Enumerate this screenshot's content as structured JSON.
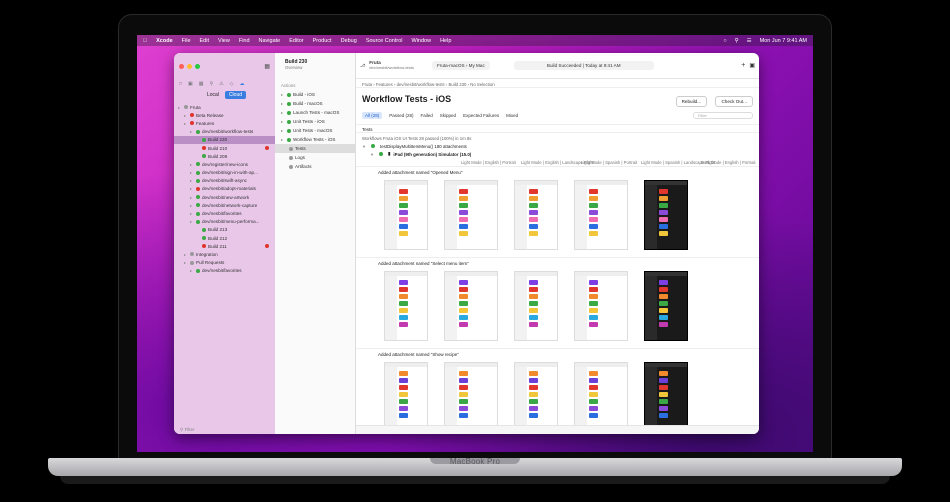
{
  "menubar": {
    "app": "Xcode",
    "items": [
      "File",
      "Edit",
      "View",
      "Find",
      "Navigate",
      "Editor",
      "Product",
      "Debug",
      "Source Control",
      "Window",
      "Help"
    ],
    "clock": "Mon Jun 7  9:41 AM"
  },
  "sidebar": {
    "segments": [
      "Local",
      "Cloud"
    ],
    "active_segment": "Cloud",
    "filter_placeholder": "Filter",
    "items": [
      {
        "label": "Fruta",
        "level": 0,
        "status": "gray"
      },
      {
        "label": "Beta Release",
        "level": 1,
        "status": "red"
      },
      {
        "label": "Features",
        "level": 1,
        "status": "red"
      },
      {
        "label": "dev/nesbit/workflow-tests",
        "level": 2,
        "status": "green"
      },
      {
        "label": "Build 230",
        "level": 3,
        "status": "green",
        "selected": true
      },
      {
        "label": "Build 210",
        "level": 3,
        "status": "red",
        "badge": true
      },
      {
        "label": "Build 209",
        "level": 3,
        "status": "green"
      },
      {
        "label": "dev/register/new-icons",
        "level": 2,
        "status": "green"
      },
      {
        "label": "dev/nesbit/sign-in-with-ap...",
        "level": 2,
        "status": "green"
      },
      {
        "label": "dev/nesbit/swift-async",
        "level": 2,
        "status": "green"
      },
      {
        "label": "dev/nesbit/adopt-materials",
        "level": 2,
        "status": "red"
      },
      {
        "label": "dev/nesbit/new-artwork",
        "level": 2,
        "status": "green"
      },
      {
        "label": "dev/nesbit/network-capture",
        "level": 2,
        "status": "green"
      },
      {
        "label": "dev/nesbit/favorites",
        "level": 2,
        "status": "green"
      },
      {
        "label": "dev/nesbit/menu-performa...",
        "level": 2,
        "status": "green"
      },
      {
        "label": "Build 213",
        "level": 3,
        "status": "green"
      },
      {
        "label": "Build 212",
        "level": 3,
        "status": "green"
      },
      {
        "label": "Build 211",
        "level": 3,
        "status": "red",
        "badge": true
      },
      {
        "label": "Integration",
        "level": 1,
        "status": "gray"
      },
      {
        "label": "Pull Requests",
        "level": 1,
        "status": "gray"
      },
      {
        "label": "dev/nesbit/favorites",
        "level": 2,
        "status": "green"
      }
    ]
  },
  "middle": {
    "title": "Build 230",
    "subtitle": "Overview",
    "section": "Actions",
    "items": [
      {
        "label": "Build - iOS",
        "status": "green"
      },
      {
        "label": "Build - macOS",
        "status": "green"
      },
      {
        "label": "Launch Tests - macOS",
        "status": "green"
      },
      {
        "label": "Unit Tests - iOS",
        "status": "green"
      },
      {
        "label": "Unit Tests - macOS",
        "status": "green"
      },
      {
        "label": "Workflow Tests - iOS",
        "status": "green"
      }
    ],
    "sub_items": [
      "Tests",
      "Logs",
      "Artifacts"
    ],
    "selected_sub": "Tests"
  },
  "toolbar": {
    "project": "Fruta",
    "branch": "dev/nesbit/workflow-tests",
    "scheme": "Fruta-macOS",
    "destination": "My Mac",
    "status": "Build Succeeded | Today at 9:41 AM",
    "breadcrumb": [
      "Fruta",
      "Features",
      "dev/nesbit/workflow-tests",
      "Build 230",
      "No Selection"
    ]
  },
  "content": {
    "title": "Workflow Tests - iOS",
    "rebuild": "Rebuild...",
    "checkout": "Check Out...",
    "filters": [
      "All (28)",
      "Passed (28)",
      "Failed",
      "Skipped",
      "Expected Failures",
      "Mixed"
    ],
    "active_filter": "All (28)",
    "search_placeholder": "Filter",
    "tests_header": "Tests",
    "crumb": "Workflows  Fruta iOS UI Tests   28 passed (100%) in 1m 8s",
    "test_name": "testDisplayMultiItemMenu() 180 attachments",
    "device": "iPad (9th generation) Simulator (15.0)",
    "configs": [
      "Light Mode | English | Portrait",
      "Light Mode | English | Landscape Right",
      "Light Mode | Spanish | Portrait",
      "Light Mode | Spanish | Landscape Right",
      "Dark Mode | English | Portrait"
    ],
    "attachments": [
      "Added attachment named \"Opened Menu\"",
      "Added attachment named \"Select menu item\"",
      "Added attachment named \"Show recipe\""
    ]
  },
  "colors": {
    "accent": "#3a7de0",
    "pass": "#3aa845",
    "fail": "#e0352b",
    "sidebar": "#e9c7e9"
  },
  "device_label": "MacBook Pro"
}
